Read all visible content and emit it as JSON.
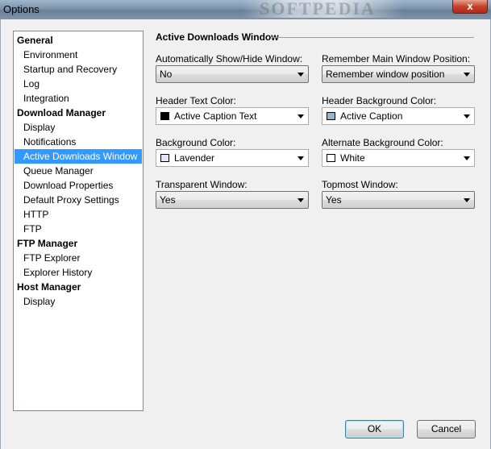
{
  "window": {
    "title": "Options",
    "close_glyph": "x",
    "watermark": "SOFTPEDIA"
  },
  "tree": [
    {
      "label": "General",
      "kind": "header"
    },
    {
      "label": "Environment",
      "kind": "item"
    },
    {
      "label": "Startup and Recovery",
      "kind": "item"
    },
    {
      "label": "Log",
      "kind": "item"
    },
    {
      "label": "Integration",
      "kind": "item"
    },
    {
      "label": "Download Manager",
      "kind": "header"
    },
    {
      "label": "Display",
      "kind": "item"
    },
    {
      "label": "Notifications",
      "kind": "item"
    },
    {
      "label": "Active Downloads Window",
      "kind": "item",
      "selected": true
    },
    {
      "label": "Queue Manager",
      "kind": "item"
    },
    {
      "label": "Download Properties",
      "kind": "item"
    },
    {
      "label": "Default Proxy Settings",
      "kind": "item"
    },
    {
      "label": "HTTP",
      "kind": "item"
    },
    {
      "label": "FTP",
      "kind": "item"
    },
    {
      "label": "FTP Manager",
      "kind": "header"
    },
    {
      "label": "FTP Explorer",
      "kind": "item"
    },
    {
      "label": "Explorer History",
      "kind": "item"
    },
    {
      "label": "Host Manager",
      "kind": "header"
    },
    {
      "label": "Display",
      "kind": "item"
    }
  ],
  "panel": {
    "title": "Active Downloads Window",
    "auto_show": {
      "label": "Automatically Show/Hide Window:",
      "value": "No"
    },
    "remember_pos": {
      "label": "Remember Main Window Position:",
      "value": "Remember window position"
    },
    "header_text_color": {
      "label": "Header Text Color:",
      "value": "Active Caption Text",
      "swatch": "#000000"
    },
    "header_bg_color": {
      "label": "Header Background Color:",
      "value": "Active Caption",
      "swatch": "#99b4d1"
    },
    "bg_color": {
      "label": "Background Color:",
      "value": "Lavender",
      "swatch": "#e6e6fa"
    },
    "alt_bg_color": {
      "label": "Alternate Background Color:",
      "value": "White",
      "swatch": "#ffffff"
    },
    "transparent": {
      "label": "Transparent Window:",
      "value": "Yes"
    },
    "topmost": {
      "label": "Topmost Window:",
      "value": "Yes"
    }
  },
  "buttons": {
    "ok": "OK",
    "cancel": "Cancel"
  }
}
